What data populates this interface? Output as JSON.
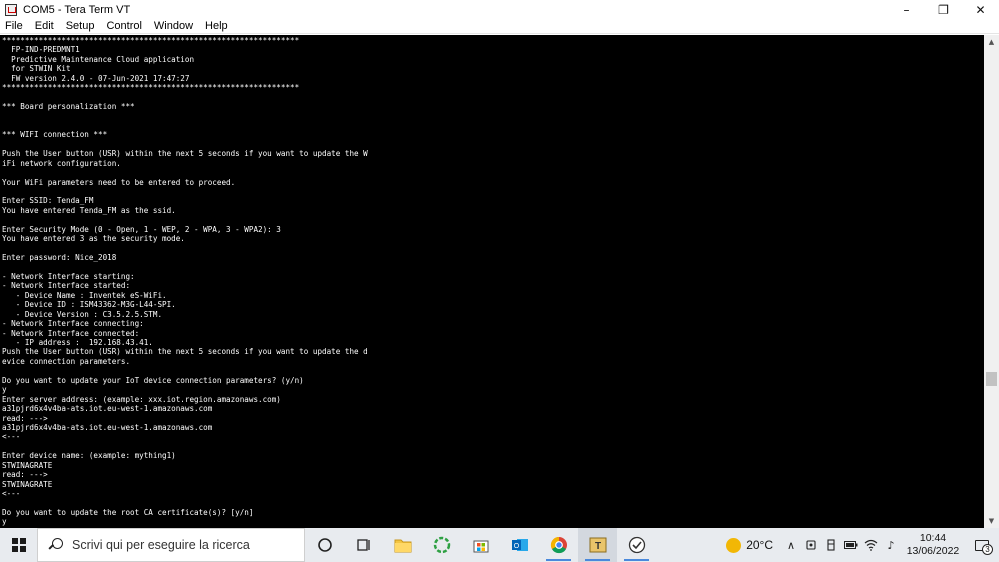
{
  "window": {
    "title": "COM5 - Tera Term VT",
    "minimize_glyph": "–",
    "restore_glyph": "❐",
    "close_glyph": "✕"
  },
  "menu": [
    "File",
    "Edit",
    "Setup",
    "Control",
    "Window",
    "Help"
  ],
  "terminal": {
    "lines": [
      "*****************************************************************",
      "  FP-IND-PREDMNT1",
      "  Predictive Maintenance Cloud application",
      "  for STWIN Kit",
      "  FW version 2.4.0 - 07-Jun-2021 17:47:27",
      "*****************************************************************",
      "",
      "*** Board personalization ***",
      "",
      "",
      "*** WIFI connection ***",
      "",
      "Push the User button (USR) within the next 5 seconds if you want to update the W",
      "iFi network configuration.",
      "",
      "Your WiFi parameters need to be entered to proceed.",
      "",
      "Enter SSID: Tenda_FM",
      "You have entered Tenda_FM as the ssid.",
      "",
      "Enter Security Mode (0 - Open, 1 - WEP, 2 - WPA, 3 - WPA2): 3",
      "You have entered 3 as the security mode.",
      "",
      "Enter password: Nice_2018",
      "",
      "- Network Interface starting:",
      "- Network Interface started:",
      "   - Device Name : Inventek eS-WiFi.",
      "   - Device ID : ISM43362-M3G-L44-SPI.",
      "   - Device Version : C3.5.2.5.STM.",
      "- Network Interface connecting:",
      "- Network Interface connected:",
      "   - IP address :  192.168.43.41.",
      "Push the User button (USR) within the next 5 seconds if you want to update the d",
      "evice connection parameters.",
      "",
      "Do you want to update your IoT device connection parameters? (y/n)",
      "y",
      "Enter server address: (example: xxx.iot.region.amazonaws.com)",
      "a31pjrd6x4v4ba-ats.iot.eu-west-1.amazonaws.com",
      "read: --->",
      "a31pjrd6x4v4ba-ats.iot.eu-west-1.amazonaws.com",
      "<---",
      "",
      "Enter device name: (example: mything1)",
      "STWINAGRATE",
      "read: --->",
      "STWINAGRATE",
      "<---",
      "",
      "Do you want to update the root CA certificate(s)? [y/n]",
      "y",
      "Do you want to update the root CA certificate(s)? [y/n]"
    ]
  },
  "taskbar": {
    "search_placeholder": "Scrivi qui per eseguire la ricerca",
    "temperature": "20°C",
    "time": "10:44",
    "date": "13/06/2022",
    "notification_count": "3",
    "tray_glyphs": {
      "chevron": "∧",
      "speaker": "♪"
    }
  },
  "colors": {
    "terminal_bg": "#000000",
    "terminal_fg": "#ffffff",
    "taskbar_bg": "#e8ebef"
  }
}
